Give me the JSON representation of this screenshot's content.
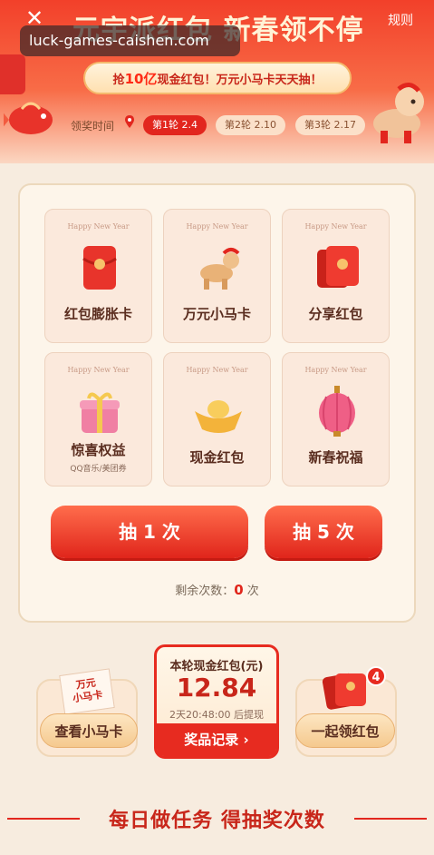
{
  "header": {
    "title": "元宇派红包 新春领不停",
    "close_icon": "close-icon",
    "rules_label": "规则",
    "url": "luck-games-caishen.com",
    "promo_prefix": "抢",
    "promo_highlight": "10亿",
    "promo_suffix": "现金红包！万元小马卡天天抽！",
    "rounds_label": "领奖时间",
    "rounds": [
      {
        "label": "第1轮 2.4",
        "active": true
      },
      {
        "label": "第2轮 2.10",
        "active": false
      },
      {
        "label": "第3轮 2.17",
        "active": false
      }
    ]
  },
  "grid": {
    "happy_new_year": "Happy New Year",
    "cards": [
      {
        "label": "红包膨胀卡",
        "sub": "",
        "icon": "red-envelope-icon"
      },
      {
        "label": "万元小马卡",
        "sub": "",
        "icon": "horse-icon"
      },
      {
        "label": "分享红包",
        "sub": "",
        "icon": "share-envelope-icon"
      },
      {
        "label": "惊喜权益",
        "sub": "QQ音乐/美团券",
        "icon": "gift-box-icon"
      },
      {
        "label": "现金红包",
        "sub": "",
        "icon": "gold-ingot-icon"
      },
      {
        "label": "新春祝福",
        "sub": "",
        "icon": "lantern-icon"
      }
    ]
  },
  "draw": {
    "once_label": "抽 1 次",
    "five_label": "抽 5 次",
    "remaining_prefix": "剩余次数：",
    "remaining_count": "0",
    "remaining_suffix": "次"
  },
  "bottom": {
    "left_card_text": "万元\n小马卡",
    "left_button": "查看小马卡",
    "center_title": "本轮现金红包(元)",
    "center_amount": "12.84",
    "center_time": "2天20:48:00 后提现",
    "center_button": "奖品记录 ›",
    "right_button": "一起领红包",
    "right_badge": "4"
  },
  "tasks": {
    "title": "每日做任务 得抽奖次数"
  },
  "colors": {
    "primary_red": "#e2261e",
    "background": "#f7ecdf",
    "gold": "#f5c98e"
  }
}
